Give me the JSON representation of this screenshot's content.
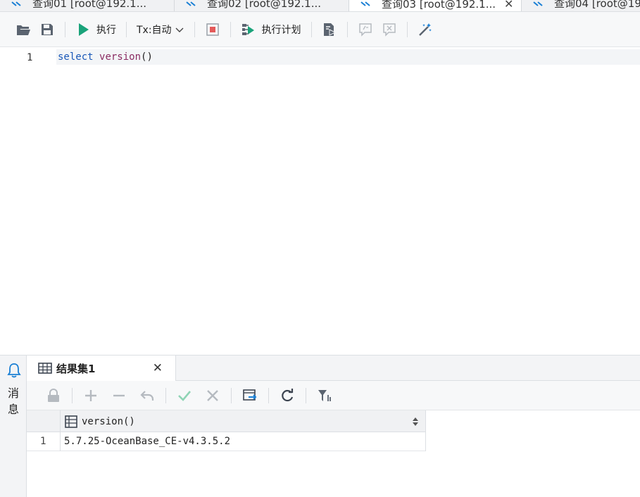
{
  "tabs": [
    {
      "label": "查询01 [root@192.1...",
      "active": false
    },
    {
      "label": "查询02 [root@192.1...",
      "active": false
    },
    {
      "label": "查询03 [root@192.1...",
      "active": true
    },
    {
      "label": "查询04 [root@19",
      "active": false
    }
  ],
  "toolbar": {
    "run_label": "执行",
    "tx_label": "Tx:自动",
    "explain_label": "执行计划"
  },
  "editor": {
    "line_number": "1",
    "code_keyword": "select",
    "code_function": "version",
    "code_parens": "()"
  },
  "side_panel": {
    "label_line1": "消",
    "label_line2": "息"
  },
  "results": {
    "tab_label": "结果集1",
    "columns": [
      "version()"
    ],
    "rows": [
      {
        "num": "1",
        "values": [
          "5.7.25-OceanBase_CE-v4.3.5.2"
        ]
      }
    ]
  },
  "colors": {
    "accent_blue": "#1a7fd4",
    "run_green": "#1aa37a",
    "stop_red": "#e45a5a"
  }
}
